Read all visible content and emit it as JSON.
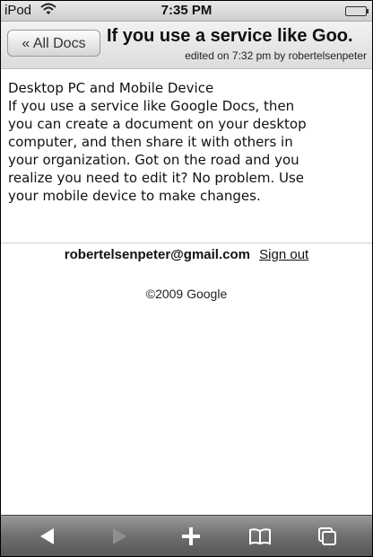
{
  "status_bar": {
    "carrier": "iPod",
    "time": "7:35 PM",
    "wifi_icon": "wifi-icon",
    "battery_icon": "battery-icon"
  },
  "header": {
    "back_label": "« All Docs",
    "title": "If you use a service like Goo.",
    "edited_info": "edited on 7:32 pm by robertelsenpeter"
  },
  "document": {
    "line1": "Desktop PC and Mobile Device",
    "lines": [
      "If you use a service like Google Docs, then",
      "you can create a document on your desktop",
      "computer, and then share it with others in",
      "your organization. Got on the road and you",
      "realize you need to edit it? No problem. Use",
      "your mobile device to make changes."
    ]
  },
  "account": {
    "email": "robertelsenpeter@gmail.com",
    "sign_out_label": "Sign out"
  },
  "footer": {
    "copyright": "©2009 Google"
  },
  "toolbar": {
    "back_icon": "back-arrow-icon",
    "forward_icon": "forward-arrow-icon",
    "add_icon": "plus-icon",
    "bookmarks_icon": "bookmarks-book-icon",
    "pages_icon": "pages-icon"
  }
}
